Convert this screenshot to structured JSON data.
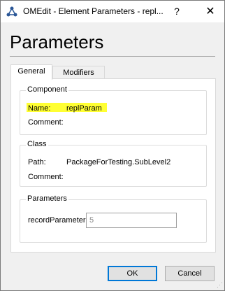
{
  "window": {
    "title": "OMEdit - Element Parameters - repl...",
    "help_label": "?",
    "close_label": "✕"
  },
  "heading": "Parameters",
  "tabs": [
    {
      "label": "General",
      "active": true
    },
    {
      "label": "Modifiers",
      "active": false
    }
  ],
  "component": {
    "group_title": "Component",
    "name_label": "Name:",
    "name_value": "replParam",
    "comment_label": "Comment:"
  },
  "class": {
    "group_title": "Class",
    "path_label": "Path:",
    "path_value": "PackageForTesting.SubLevel2",
    "comment_label": "Comment:"
  },
  "parameters": {
    "group_title": "Parameters",
    "record_label": "recordParameter",
    "record_placeholder": "5"
  },
  "buttons": {
    "ok_label": "OK",
    "cancel_label": "Cancel"
  },
  "colors": {
    "highlight": "#ffff33",
    "focus_border": "#0078d7"
  },
  "icons": {
    "app": "omedit-logo-icon",
    "close": "close-icon",
    "help": "help-icon",
    "resize": "resize-grip-icon"
  }
}
